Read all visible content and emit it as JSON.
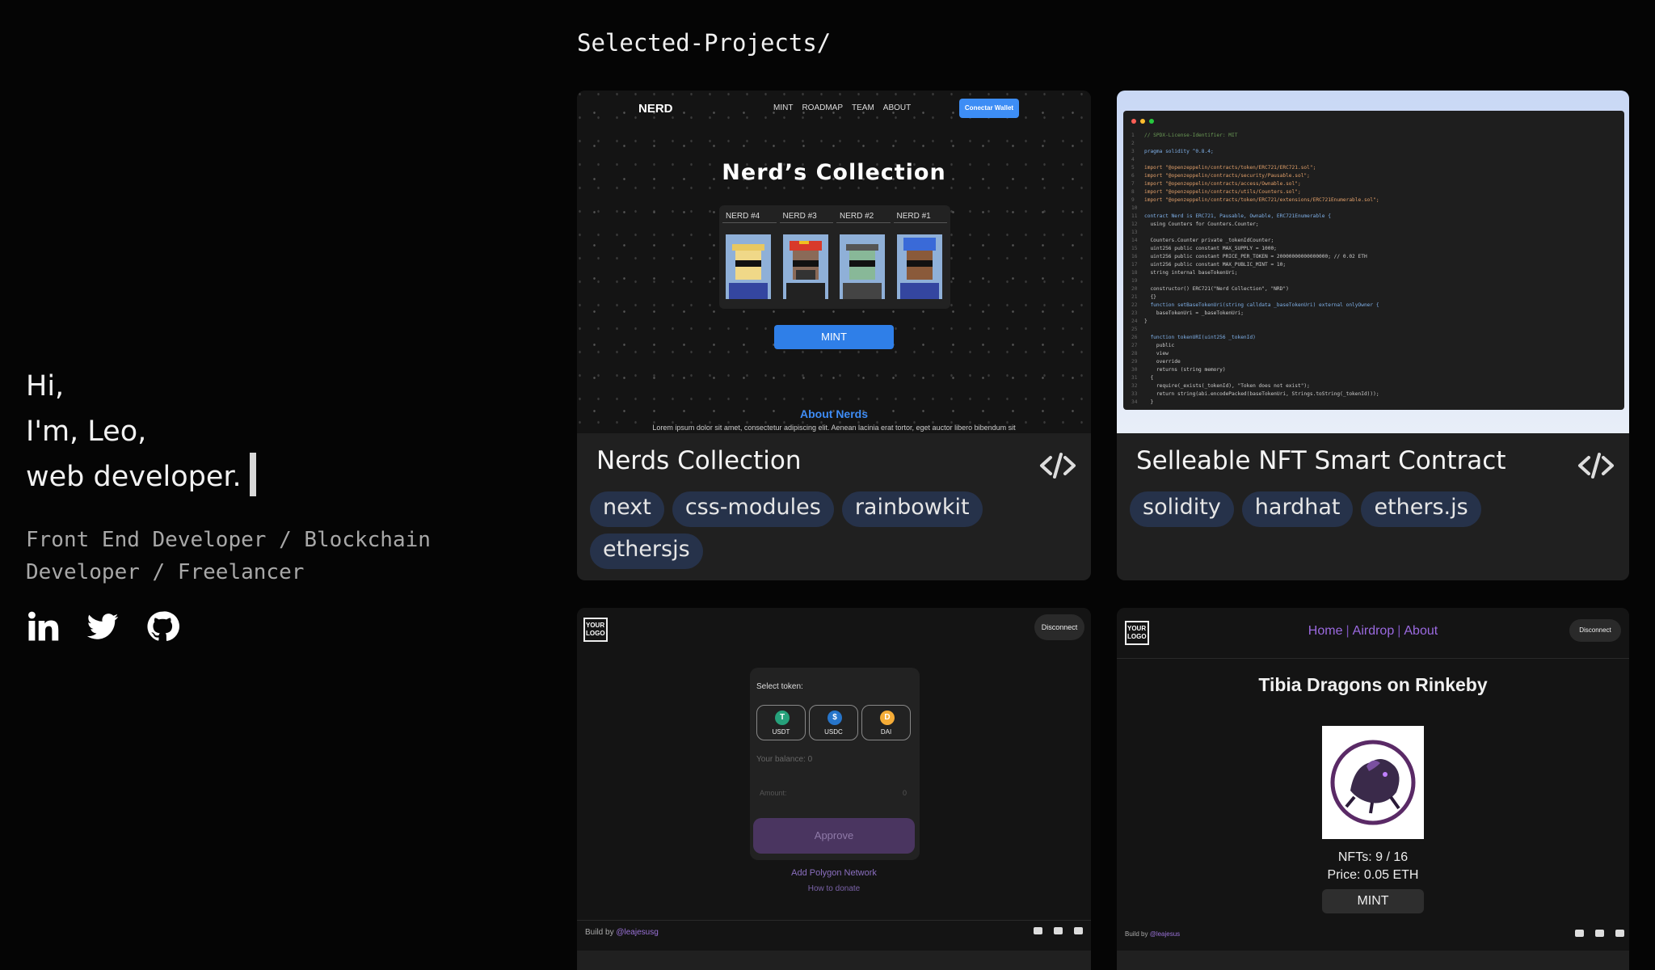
{
  "intro": {
    "line1": "Hi,",
    "line2": "I'm, Leo,",
    "line3": "web developer.",
    "subtitle": "Front End Developer / Blockchain Developer / Freelancer",
    "socials": [
      "linkedin-icon",
      "twitter-icon",
      "github-icon"
    ]
  },
  "projects": {
    "section_title": "Selected-Projects/",
    "items": [
      {
        "title": "Nerds Collection",
        "tags": [
          "next",
          "css-modules",
          "rainbowkit",
          "ethersjs"
        ],
        "preview": {
          "logo": "NERD",
          "nav": [
            "MINT",
            "ROADMAP",
            "TEAM",
            "ABOUT"
          ],
          "wallet_button": "Conectar Wallet",
          "heading": "Nerd’s Collection",
          "cards": [
            "NERD #4",
            "NERD #3",
            "NERD #2",
            "NERD #1"
          ],
          "mint_button": "MINT",
          "about_heading": "About Nerds",
          "about_text": "Lorem ipsum dolor sit amet, consectetur adipiscing elit. Aenean lacinia erat tortor, eget auctor libero bibendum sit"
        }
      },
      {
        "title": "Selleable NFT Smart Contract",
        "tags": [
          "solidity",
          "hardhat",
          "ethers.js"
        ],
        "preview": {
          "code": [
            "// SPDX-License-Identifier: MIT",
            "",
            "pragma solidity ^0.8.4;",
            "",
            "import \"@openzeppelin/contracts/token/ERC721/ERC721.sol\";",
            "import \"@openzeppelin/contracts/security/Pausable.sol\";",
            "import \"@openzeppelin/contracts/access/Ownable.sol\";",
            "import \"@openzeppelin/contracts/utils/Counters.sol\";",
            "import \"@openzeppelin/contracts/token/ERC721/extensions/ERC721Enumerable.sol\";",
            "",
            "contract Nerd is ERC721, Pausable, Ownable, ERC721Enumerable {",
            "  using Counters for Counters.Counter;",
            "",
            "  Counters.Counter private _tokenIdCounter;",
            "  uint256 public constant MAX_SUPPLY = 1000;",
            "  uint256 public constant PRICE_PER_TOKEN = 20000000000000000; // 0.02 ETH",
            "  uint256 public constant MAX_PUBLIC_MINT = 10;",
            "  string internal baseTokenUri;",
            "",
            "  constructor() ERC721(\"Nerd Collection\", \"NRD\")",
            "  {}",
            "  function setBaseTokenUri(string calldata _baseTokenUri) external onlyOwner {",
            "    baseTokenUri = _baseTokenUri;",
            "}",
            "",
            "  function tokenURI(uint256 _tokenId)",
            "    public",
            "    view",
            "    override",
            "    returns (string memory)",
            "  {",
            "    require(_exists(_tokenId), \"Token does not exist\");",
            "    return string(abi.encodePacked(baseTokenUri, Strings.toString(_tokenId)));",
            "  }"
          ]
        }
      },
      {
        "preview": {
          "logo_text": "YOUR LOGO",
          "disconnect": "Disconnect",
          "select_label": "Select token:",
          "tokens": [
            {
              "name": "USDT",
              "glyph": "T",
              "color": "#26a17b"
            },
            {
              "name": "USDC",
              "glyph": "$",
              "color": "#2775ca"
            },
            {
              "name": "DAI",
              "glyph": "D",
              "color": "#f5ac37"
            }
          ],
          "balance_label": "Your balance:",
          "balance_value": "0",
          "amount_placeholder": "Amount:",
          "amount_value": "0",
          "approve_button": "Approve",
          "link_polygon": "Add Polygon Network",
          "link_donate": "How to donate",
          "footer_prefix": "Build by",
          "footer_handle": "@leajesusg"
        }
      },
      {
        "preview": {
          "logo_text": "YOUR LOGO",
          "nav": [
            "Home",
            "Airdrop",
            "About"
          ],
          "nav_separator": "|",
          "disconnect": "Disconnect",
          "heading": "Tibia Dragons on Rinkeby",
          "nfts": "NFTs: 9 / 16",
          "price": "Price: 0.05 ETH",
          "mint_button": "MINT",
          "footer_prefix": "Build by",
          "footer_handle": "@leajesus"
        }
      }
    ]
  },
  "colors": {
    "background": "#050505",
    "card": "#202020",
    "tag": "#26324a",
    "accent_blue": "#3d8df5",
    "accent_purple": "#9b6ae0"
  }
}
